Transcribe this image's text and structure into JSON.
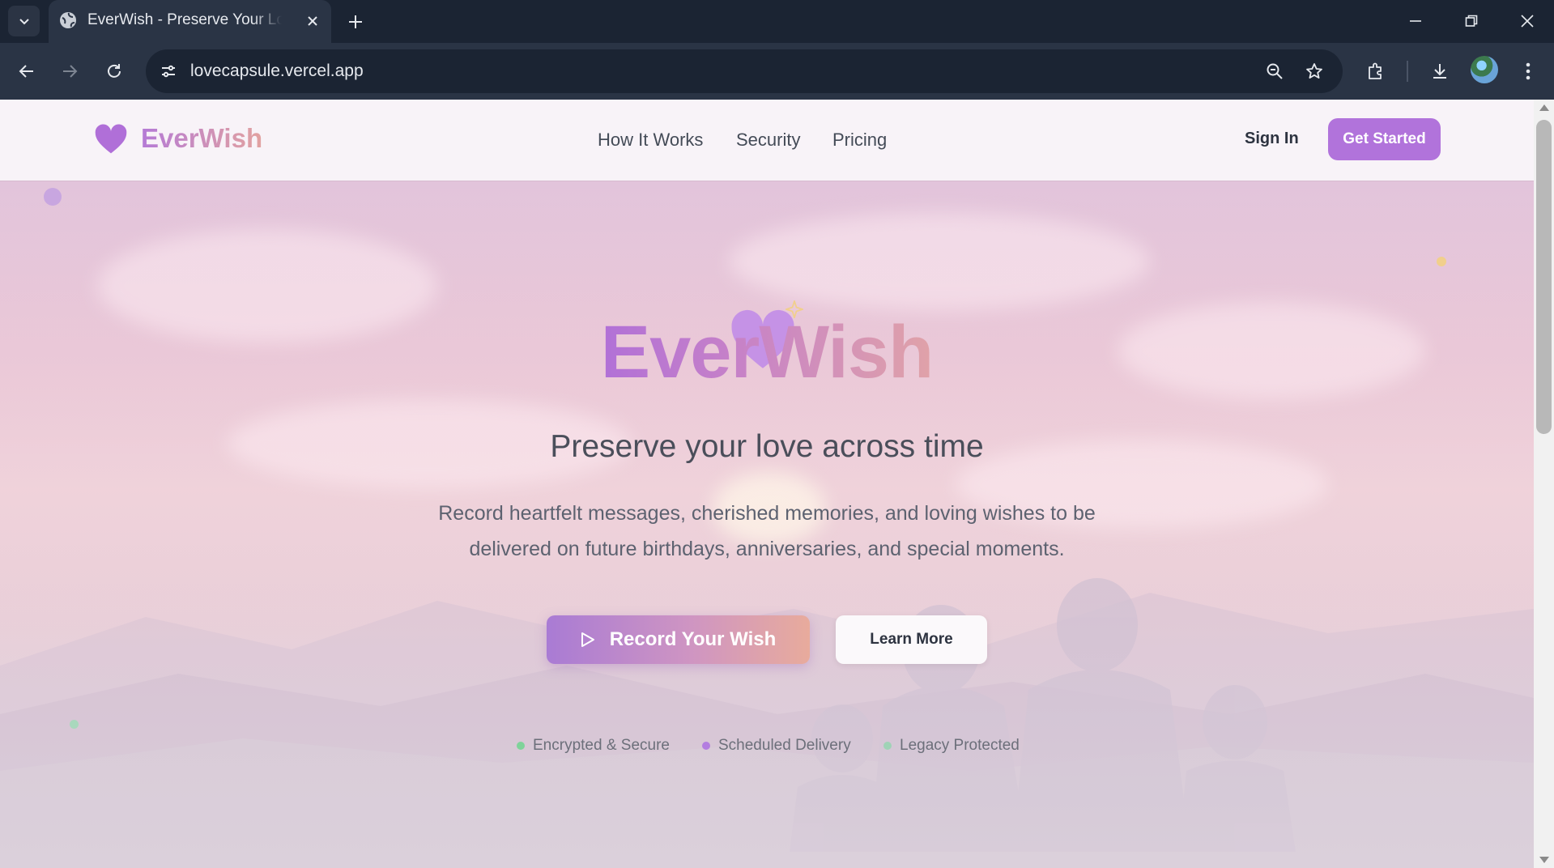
{
  "browser": {
    "tab_title": "EverWish - Preserve Your Love Across Time",
    "url": "lovecapsule.vercel.app",
    "icons": [
      "tab-search-icon",
      "globe-icon",
      "close-icon",
      "plus-icon",
      "minimize-icon",
      "restore-icon",
      "window-close-icon",
      "back-icon",
      "forward-icon",
      "reload-icon",
      "site-info-icon",
      "zoom-icon",
      "star-icon",
      "extensions-icon",
      "download-icon",
      "profile-avatar",
      "kebab-menu-icon"
    ]
  },
  "header": {
    "logo_text": "EverWish",
    "nav": [
      "How It Works",
      "Security",
      "Pricing"
    ],
    "sign_in": "Sign In",
    "get_started": "Get Started"
  },
  "hero": {
    "title": "EverWish",
    "subtitle": "Preserve your love across time",
    "description_line1": "Record heartfelt messages, cherished memories, and loving wishes to be",
    "description_line2": "delivered on future birthdays, anniversaries, and special moments.",
    "record_button": "Record Your Wish",
    "learn_more": "Learn More",
    "features": [
      {
        "label": "Encrypted & Secure",
        "color": "#7fd39a"
      },
      {
        "label": "Scheduled Delivery",
        "color": "#b37ee0"
      },
      {
        "label": "Legacy Protected",
        "color": "#9fd3b6"
      }
    ]
  },
  "colors": {
    "brand_purple": "#b173db",
    "brand_peach": "#e2a2a0",
    "browser_bg": "#1b2433"
  }
}
